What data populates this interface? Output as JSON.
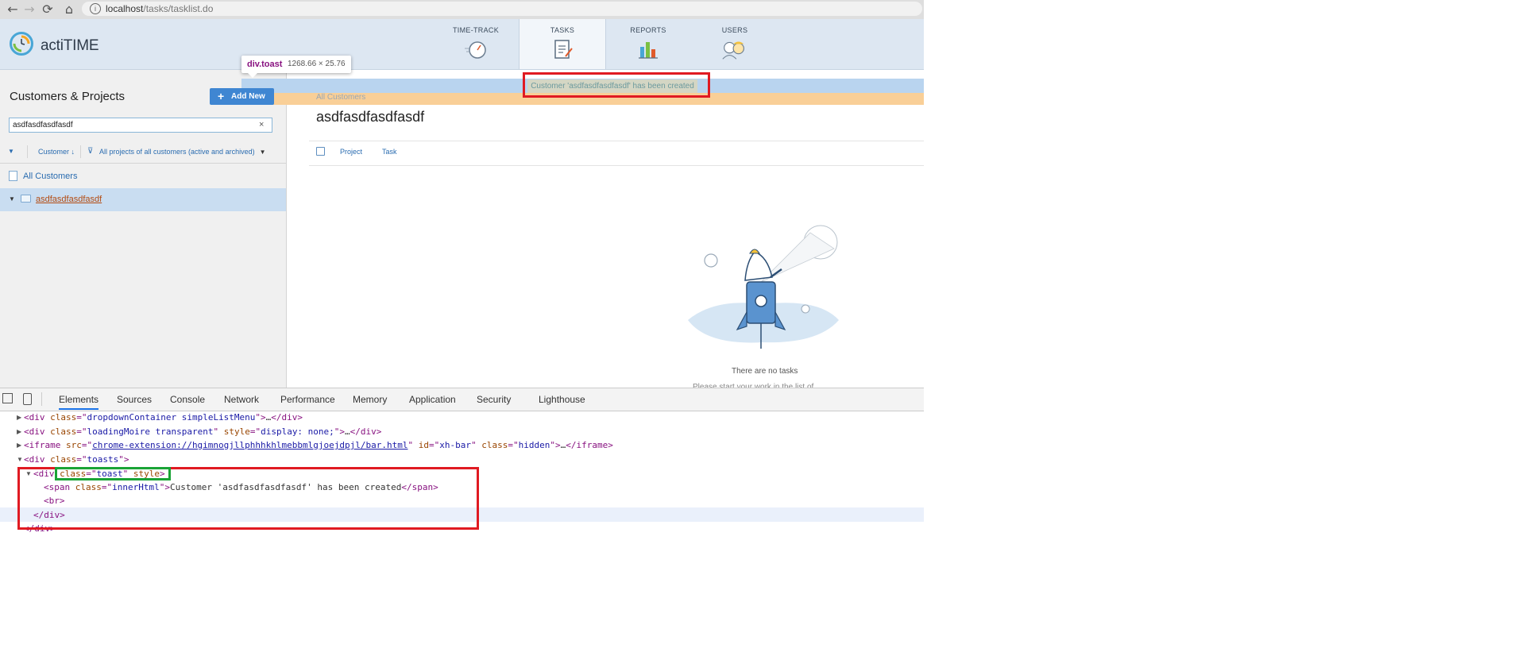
{
  "browser": {
    "url_host": "localhost",
    "url_path": "/tasks/tasklist.do",
    "back_icon": "←",
    "forward_icon": "→",
    "reload_icon": "⟳",
    "home_icon": "⌂"
  },
  "app": {
    "logo_text": "actiTIME",
    "nav": [
      {
        "label": "TIME-TRACK",
        "icon": "stopwatch-icon"
      },
      {
        "label": "TASKS",
        "icon": "clipboard-icon"
      },
      {
        "label": "REPORTS",
        "icon": "bar-chart-icon"
      },
      {
        "label": "USERS",
        "icon": "users-icon"
      }
    ],
    "active_tab": "TASKS"
  },
  "tooltip": {
    "selector": "div.toast",
    "dimensions": "1268.66 × 25.76"
  },
  "left_panel": {
    "title": "Customers & Projects",
    "add_new_label": "Add New",
    "search_value": "asdfasdfasdfasdf",
    "clear_icon": "×",
    "sort_label": "Customer ↓",
    "filter_label": "All projects of all customers (active and archived)",
    "all_customers_label": "All Customers",
    "customers": [
      {
        "name": "asdfasdfasdfasdf",
        "selected": true
      }
    ]
  },
  "toast": {
    "message": "Customer 'asdfasdfasdfasdf' has been created",
    "breadcrumb": "All Customers"
  },
  "main": {
    "customer_title": "asdfasdfasdfasdf",
    "columns": [
      "Project",
      "Task"
    ],
    "empty_title": "There are no tasks",
    "empty_hint": "Please start your work in the list of..."
  },
  "devtools": {
    "tabs": [
      "Elements",
      "Sources",
      "Console",
      "Network",
      "Performance",
      "Memory",
      "Application",
      "Security",
      "Lighthouse"
    ],
    "active_tab": "Elements",
    "lines": {
      "l1_class": "dropdownContainer simpleListMenu",
      "l2_class": "loadingMoire transparent",
      "l2_style": "display: none;",
      "l3_src": "chrome-extension://hgimnogjllphhhkhlmebbmlgjoejdpjl/bar.html",
      "l3_id": "xh-bar",
      "l3_class": "hidden",
      "l4_class": "toasts",
      "l5_class": "toast",
      "l6_class": "innerHtml",
      "l6_text": "Customer 'asdfasdfasdfasdf' has been created"
    }
  },
  "colors": {
    "accent_blue": "#3f86d2",
    "toast_blue": "#b9d4ef",
    "toast_orange": "#f9cf97",
    "highlight_red": "#e01a22",
    "highlight_green": "#1aa336"
  }
}
